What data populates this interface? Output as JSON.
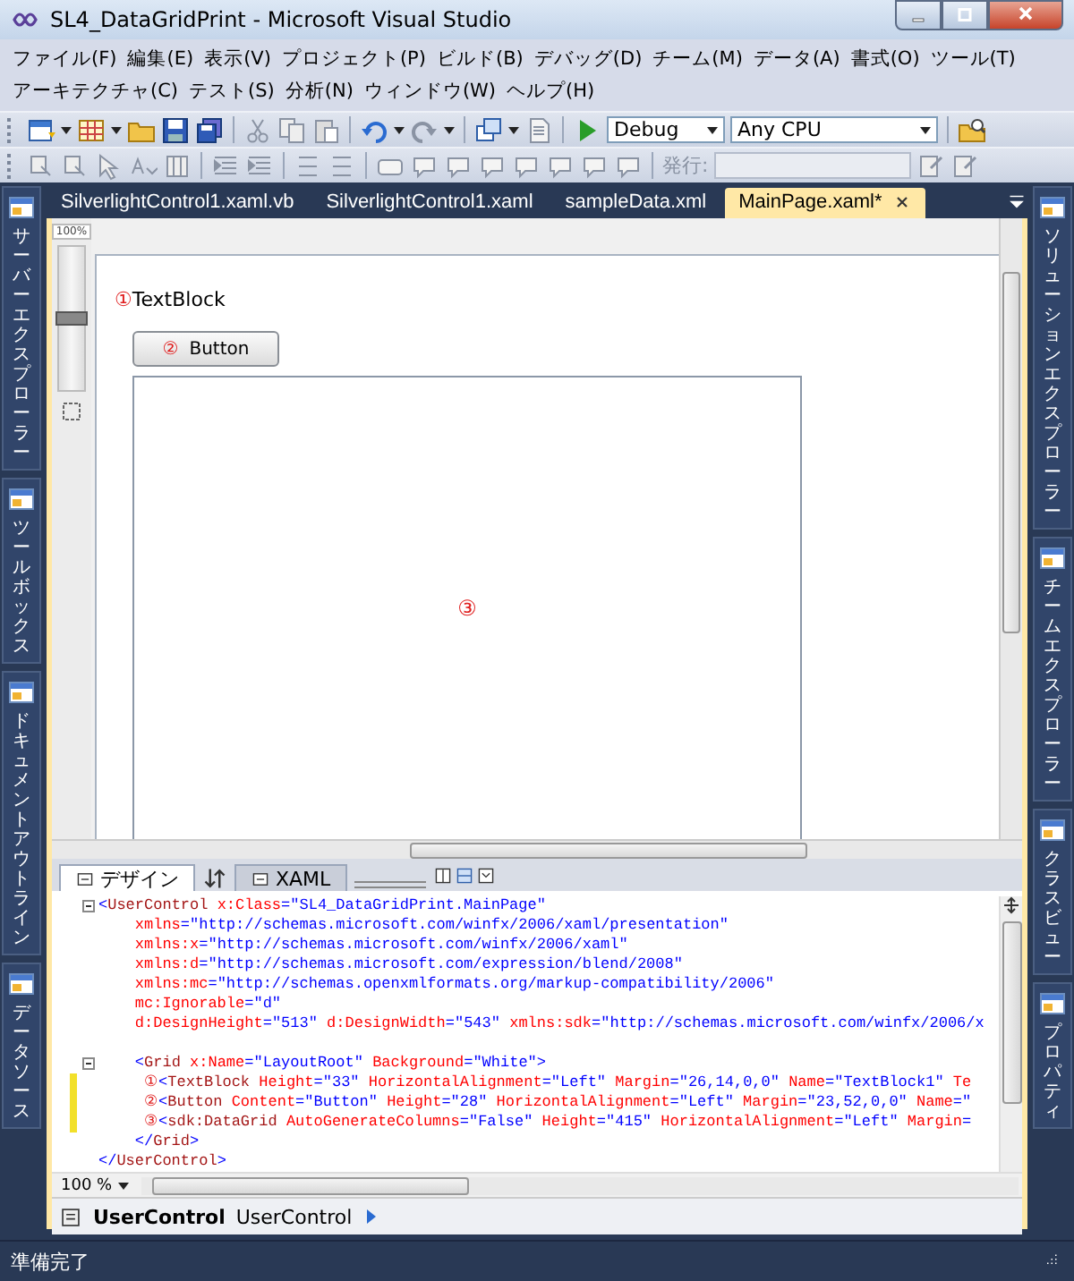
{
  "window": {
    "title": "SL4_DataGridPrint - Microsoft Visual Studio"
  },
  "menu_rows": [
    [
      "ファイル(F)",
      "編集(E)",
      "表示(V)",
      "プロジェクト(P)",
      "ビルド(B)",
      "デバッグ(D)",
      "チーム(M)",
      "データ(A)",
      "書式(O)",
      "ツール(T)"
    ],
    [
      "アーキテクチャ(C)",
      "テスト(S)",
      "分析(N)",
      "ウィンドウ(W)",
      "ヘルプ(H)"
    ]
  ],
  "toolbar": {
    "configuration": "Debug",
    "platform": "Any CPU",
    "publish_label": "発行:"
  },
  "left_tool_tabs": [
    "サーバーエクスプローラー",
    "ツールボックス",
    "ドキュメントアウトライン",
    "データソース"
  ],
  "right_tool_tabs": [
    "ソリューションエクスプローラー",
    "チームエクスプローラー",
    "クラスビュー",
    "プロパティ"
  ],
  "document_tabs": [
    {
      "label": "SilverlightControl1.xaml.vb",
      "selected": false
    },
    {
      "label": "SilverlightControl1.xaml",
      "selected": false
    },
    {
      "label": "sampleData.xml",
      "selected": false
    },
    {
      "label": "MainPage.xaml*",
      "selected": true
    }
  ],
  "design_surface": {
    "zoom_slider": {
      "label": "100%",
      "level": 0.5
    },
    "elements": [
      {
        "kind": "textblock",
        "marker": "①",
        "text": "TextBlock"
      },
      {
        "kind": "button",
        "marker": "②",
        "text": "Button"
      },
      {
        "kind": "datagrid",
        "marker": "③"
      }
    ]
  },
  "view_tabs": [
    {
      "label": "デザイン",
      "selected": true
    },
    {
      "label": "XAML",
      "selected": false
    }
  ],
  "code_lines": [
    {
      "kind": "code",
      "foldable": true,
      "changed": false,
      "segments": [
        {
          "kind": "punct",
          "text": "<"
        },
        {
          "kind": "tag",
          "text": "UserControl"
        },
        {
          "kind": "attr",
          "text": " x:Class"
        },
        {
          "kind": "punct",
          "text": "="
        },
        {
          "kind": "value",
          "text": "\"SL4_DataGridPrint.MainPage\""
        }
      ]
    },
    {
      "kind": "code",
      "foldable": false,
      "changed": false,
      "segments": [
        {
          "kind": "attr",
          "text": "    xmlns"
        },
        {
          "kind": "punct",
          "text": "="
        },
        {
          "kind": "value",
          "text": "\"http://schemas.microsoft.com/winfx/2006/xaml/presentation\""
        }
      ]
    },
    {
      "kind": "code",
      "foldable": false,
      "changed": false,
      "segments": [
        {
          "kind": "attr",
          "text": "    xmlns:x"
        },
        {
          "kind": "punct",
          "text": "="
        },
        {
          "kind": "value",
          "text": "\"http://schemas.microsoft.com/winfx/2006/xaml\""
        }
      ]
    },
    {
      "kind": "code",
      "foldable": false,
      "changed": false,
      "segments": [
        {
          "kind": "attr",
          "text": "    xmlns:d"
        },
        {
          "kind": "punct",
          "text": "="
        },
        {
          "kind": "value",
          "text": "\"http://schemas.microsoft.com/expression/blend/2008\""
        }
      ]
    },
    {
      "kind": "code",
      "foldable": false,
      "changed": false,
      "segments": [
        {
          "kind": "attr",
          "text": "    xmlns:mc"
        },
        {
          "kind": "punct",
          "text": "="
        },
        {
          "kind": "value",
          "text": "\"http://schemas.openxmlformats.org/markup-compatibility/2006\""
        }
      ]
    },
    {
      "kind": "code",
      "foldable": false,
      "changed": false,
      "segments": [
        {
          "kind": "attr",
          "text": "    mc:Ignorable"
        },
        {
          "kind": "punct",
          "text": "="
        },
        {
          "kind": "value",
          "text": "\"d\""
        }
      ]
    },
    {
      "kind": "code",
      "foldable": false,
      "changed": false,
      "segments": [
        {
          "kind": "attr",
          "text": "    d:DesignHeight"
        },
        {
          "kind": "punct",
          "text": "="
        },
        {
          "kind": "value",
          "text": "\"513\""
        },
        {
          "kind": "attr",
          "text": " d:DesignWidth"
        },
        {
          "kind": "punct",
          "text": "="
        },
        {
          "kind": "value",
          "text": "\"543\""
        },
        {
          "kind": "attr",
          "text": " xmlns:sdk"
        },
        {
          "kind": "punct",
          "text": "="
        },
        {
          "kind": "value",
          "text": "\"http://schemas.microsoft.com/winfx/2006/x"
        }
      ]
    },
    {
      "kind": "blank"
    },
    {
      "kind": "code",
      "foldable": true,
      "changed": false,
      "segments": [
        {
          "kind": "punct",
          "text": "    <"
        },
        {
          "kind": "tag",
          "text": "Grid"
        },
        {
          "kind": "attr",
          "text": " x:Name"
        },
        {
          "kind": "punct",
          "text": "="
        },
        {
          "kind": "value",
          "text": "\"LayoutRoot\""
        },
        {
          "kind": "attr",
          "text": " Background"
        },
        {
          "kind": "punct",
          "text": "="
        },
        {
          "kind": "value",
          "text": "\"White\""
        },
        {
          "kind": "punct",
          "text": ">"
        }
      ]
    },
    {
      "kind": "code",
      "foldable": false,
      "changed": true,
      "segments": [
        {
          "kind": "marker",
          "text": "     ①"
        },
        {
          "kind": "punct",
          "text": "<"
        },
        {
          "kind": "tag",
          "text": "TextBlock"
        },
        {
          "kind": "attr",
          "text": " Height"
        },
        {
          "kind": "punct",
          "text": "="
        },
        {
          "kind": "value",
          "text": "\"33\""
        },
        {
          "kind": "attr",
          "text": " HorizontalAlignment"
        },
        {
          "kind": "punct",
          "text": "="
        },
        {
          "kind": "value",
          "text": "\"Left\""
        },
        {
          "kind": "attr",
          "text": " Margin"
        },
        {
          "kind": "punct",
          "text": "="
        },
        {
          "kind": "value",
          "text": "\"26,14,0,0\""
        },
        {
          "kind": "attr",
          "text": " Name"
        },
        {
          "kind": "punct",
          "text": "="
        },
        {
          "kind": "value",
          "text": "\"TextBlock1\""
        },
        {
          "kind": "attr",
          "text": " Te"
        }
      ]
    },
    {
      "kind": "code",
      "foldable": false,
      "changed": true,
      "segments": [
        {
          "kind": "marker",
          "text": "     ②"
        },
        {
          "kind": "punct",
          "text": "<"
        },
        {
          "kind": "tag",
          "text": "Button"
        },
        {
          "kind": "attr",
          "text": " Content"
        },
        {
          "kind": "punct",
          "text": "="
        },
        {
          "kind": "value",
          "text": "\"Button\""
        },
        {
          "kind": "attr",
          "text": " Height"
        },
        {
          "kind": "punct",
          "text": "="
        },
        {
          "kind": "value",
          "text": "\"28\""
        },
        {
          "kind": "attr",
          "text": " HorizontalAlignment"
        },
        {
          "kind": "punct",
          "text": "="
        },
        {
          "kind": "value",
          "text": "\"Left\""
        },
        {
          "kind": "attr",
          "text": " Margin"
        },
        {
          "kind": "punct",
          "text": "="
        },
        {
          "kind": "value",
          "text": "\"23,52,0,0\""
        },
        {
          "kind": "attr",
          "text": " Name"
        },
        {
          "kind": "punct",
          "text": "="
        },
        {
          "kind": "value",
          "text": "\""
        }
      ]
    },
    {
      "kind": "code",
      "foldable": false,
      "changed": true,
      "segments": [
        {
          "kind": "marker",
          "text": "     ③"
        },
        {
          "kind": "punct",
          "text": "<"
        },
        {
          "kind": "tag",
          "text": "sdk:DataGrid"
        },
        {
          "kind": "attr",
          "text": " AutoGenerateColumns"
        },
        {
          "kind": "punct",
          "text": "="
        },
        {
          "kind": "value",
          "text": "\"False\""
        },
        {
          "kind": "attr",
          "text": " Height"
        },
        {
          "kind": "punct",
          "text": "="
        },
        {
          "kind": "value",
          "text": "\"415\""
        },
        {
          "kind": "attr",
          "text": " HorizontalAlignment"
        },
        {
          "kind": "punct",
          "text": "="
        },
        {
          "kind": "value",
          "text": "\"Left\""
        },
        {
          "kind": "attr",
          "text": " Margin"
        },
        {
          "kind": "punct",
          "text": "="
        }
      ]
    },
    {
      "kind": "code",
      "foldable": false,
      "changed": false,
      "segments": [
        {
          "kind": "punct",
          "text": "    </"
        },
        {
          "kind": "tag",
          "text": "Grid"
        },
        {
          "kind": "punct",
          "text": ">"
        }
      ]
    },
    {
      "kind": "code",
      "foldable": false,
      "changed": false,
      "segments": [
        {
          "kind": "punct",
          "text": "</"
        },
        {
          "kind": "tag",
          "text": "UserControl"
        },
        {
          "kind": "punct",
          "text": ">"
        }
      ]
    }
  ],
  "editor_zoom": "100 %",
  "breadcrumb": [
    {
      "label": "UserControl",
      "selected": true
    },
    {
      "label": "UserControl",
      "selected": false
    }
  ],
  "status_bar": {
    "text": "準備完了"
  }
}
